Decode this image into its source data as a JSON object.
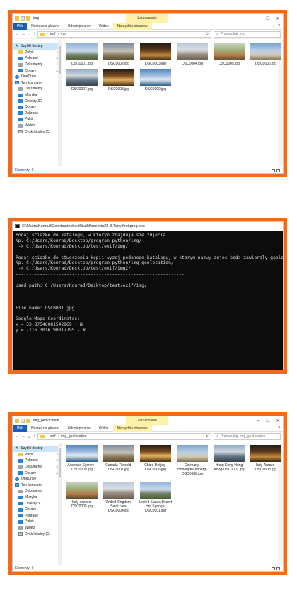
{
  "explorer1": {
    "manage_tab": "Zarządzanie",
    "window_title": "img",
    "tabs": [
      "Plik",
      "Narzędzia główne",
      "Udostępnianie",
      "Widok",
      "Narzędzia obrazów"
    ],
    "path": [
      "exif",
      "img"
    ],
    "search_placeholder": "Przeszukaj: img",
    "nav": [
      {
        "label": "Szybki dostęp",
        "icon": "star-icon",
        "level": "top",
        "selected": true
      },
      {
        "label": "Pulpit",
        "icon": "folder-icon",
        "pinned": true
      },
      {
        "label": "Pobrane",
        "icon": "download-icon",
        "pinned": true
      },
      {
        "label": "Dokumenty",
        "icon": "documents-icon",
        "pinned": true
      },
      {
        "label": "Obrazy",
        "icon": "pictures-icon",
        "pinned": true
      },
      {
        "label": "",
        "icon": "",
        "gap": true
      },
      {
        "label": "OneDrive",
        "icon": "cloud-icon",
        "level": "top"
      },
      {
        "label": "Ten komputer",
        "icon": "computer-icon",
        "level": "top"
      },
      {
        "label": "Dokumenty",
        "icon": "documents-icon"
      },
      {
        "label": "Muzyka",
        "icon": "music-icon"
      },
      {
        "label": "Obiekty 3D",
        "icon": "objects3d-icon"
      },
      {
        "label": "Obrazy",
        "icon": "pictures-icon"
      },
      {
        "label": "Pobrane",
        "icon": "download-icon"
      },
      {
        "label": "Pulpit",
        "icon": "desktop-icon"
      },
      {
        "label": "Wideo",
        "icon": "video-icon"
      },
      {
        "label": "Dysk lokalny (C:",
        "icon": "drive-icon"
      }
    ],
    "files": [
      {
        "name": "DSC0001.jpg",
        "photo": "ph1"
      },
      {
        "name": "DSC0002.jpg",
        "photo": "ph2"
      },
      {
        "name": "DSC0003.jpg",
        "photo": "ph3"
      },
      {
        "name": "DSC0004.jpg",
        "photo": "ph4"
      },
      {
        "name": "DSC0005.jpg",
        "photo": "ph5"
      },
      {
        "name": "DSC0006.jpg",
        "photo": "ph6"
      },
      {
        "name": "DSC0007.jpg",
        "photo": "ph7"
      },
      {
        "name": "DSC0008.jpg",
        "photo": "ph8"
      },
      {
        "name": "DSC0009.jpg",
        "photo": "ph9"
      }
    ],
    "status": "Elementy: 9"
  },
  "console": {
    "title": "C:\\Users\\Konrad\\Desktop\\test\\exif\\build\\exe.win32-3.7\\my first prog.exe",
    "lines": [
      "Podaj sciezke do katalogu, w ktorym znajduja sie zdjecia",
      "Np. C:/Users/Konrad/Desktop/program_python/img/",
      " -> C:/Users/Konrad/Desktop/test/exif/img/",
      "",
      "Podaj sciezke do stworzenia kopii wyzej podanego katalogu, w ktorym nazwy zdjec beda zawieraly geolokacje",
      "Np. C:/Users/Konrad/Desktop/program_python/img_geolocation/",
      " -> C:/Users/Konrad/Desktop/test/exif/img2/",
      "---------------------------------------------------------------",
      "",
      "Used path: C:/Users/Konrad/Desktop/test/exif/img/",
      "",
      "---------------------------------------------------------------",
      "",
      "File name: DSC0001.jpg",
      "",
      "Google Maps Coordinates:",
      "x = 33.87546081542969 - N",
      "y = -116.3016190017795 - W"
    ]
  },
  "explorer2": {
    "manage_tab": "Zarządzanie",
    "window_title": "img_geolocation",
    "tabs": [
      "Plik",
      "Narzędzia główne",
      "Udostępnianie",
      "Widok",
      "Narzędzia obrazów"
    ],
    "path": [
      "exif",
      "img_geolocation"
    ],
    "search_placeholder": "Przeszukaj: img_geolocation",
    "nav": [
      {
        "label": "Szybki dostęp",
        "icon": "star-icon",
        "level": "top",
        "selected": true
      },
      {
        "label": "Pulpit",
        "icon": "folder-icon",
        "pinned": true
      },
      {
        "label": "Pobrane",
        "icon": "download-icon",
        "pinned": true
      },
      {
        "label": "Dokumenty",
        "icon": "documents-icon",
        "pinned": true
      },
      {
        "label": "Obrazy",
        "icon": "pictures-icon",
        "pinned": true
      },
      {
        "label": "",
        "icon": "",
        "gap": true
      },
      {
        "label": "OneDrive",
        "icon": "cloud-icon",
        "level": "top"
      },
      {
        "label": "Ten komputer",
        "icon": "computer-icon",
        "level": "top"
      },
      {
        "label": "Dokumenty",
        "icon": "documents-icon"
      },
      {
        "label": "Muzyka",
        "icon": "music-icon"
      },
      {
        "label": "Obiekty 3D",
        "icon": "objects3d-icon"
      },
      {
        "label": "Obrazy",
        "icon": "pictures-icon"
      },
      {
        "label": "Pobrane",
        "icon": "download-icon"
      },
      {
        "label": "Pulpit",
        "icon": "desktop-icon"
      },
      {
        "label": "Wideo",
        "icon": "video-icon"
      },
      {
        "label": "Dysk lokalny (C:",
        "icon": "drive-icon"
      }
    ],
    "files": [
      {
        "name": "Australia-Sydney--DSC0009.jpg",
        "photo": "ph9"
      },
      {
        "name": "Canada-Thorold-DSC0007.jpg",
        "photo": "ph2"
      },
      {
        "name": "China-Beijing-DSC0008.jpg",
        "photo": "ph8"
      },
      {
        "name": "Germany-Hohenpeißenberg-DSC0006.jpg",
        "photo": "ph6"
      },
      {
        "name": "Hong Kong-Hong Kong-DSC0002.jpg",
        "photo": "ph7"
      },
      {
        "name": "Italy-Arezzo-DSC0003.jpg",
        "photo": "ph3"
      },
      {
        "name": "Italy-Arezzo-DSC0005.jpg",
        "photo": "ph5"
      },
      {
        "name": "United Kingdom-Saint Ives-DSC0004.jpg",
        "photo": "ph4"
      },
      {
        "name": "United States-Desert Hot Springs-DSC0001.jpg",
        "photo": "ph1"
      }
    ],
    "status": "Elementy: 9"
  }
}
